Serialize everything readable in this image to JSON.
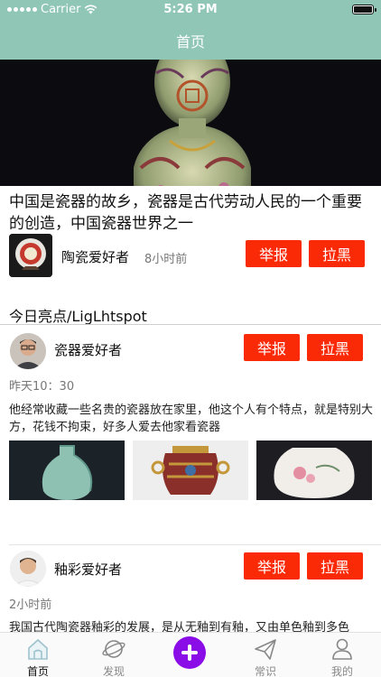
{
  "status_bar": {
    "carrier": "Carrier",
    "time": "5:26 PM"
  },
  "nav": {
    "title": "首页"
  },
  "hero": {
    "caption": "中国是瓷器的故乡，瓷器是古代劳动人民的一个重要的创造，中国瓷器世界之一",
    "author": "陶瓷爱好者",
    "time": "8小时前",
    "report_label": "举报",
    "block_label": "拉黑"
  },
  "section": {
    "title": "今日亮点/LigLhtspot"
  },
  "posts": [
    {
      "author": "瓷器爱好者",
      "time": "昨天10：30",
      "text": "他经常收藏一些名贵的瓷器放在家里，他这个人有个特点，就是特别大方，花钱不拘束，好多人爱去他家看瓷器",
      "report_label": "举报",
      "block_label": "拉黑"
    },
    {
      "author": "釉彩爱好者",
      "time": "2小时前",
      "text": "我国古代陶瓷器釉彩的发展，是从无釉到有釉，又由单色釉到多色",
      "report_label": "举报",
      "block_label": "拉黑"
    }
  ],
  "tabbar": {
    "home": "首页",
    "discover": "发现",
    "knowledge": "常识",
    "mine": "我的"
  },
  "colors": {
    "nav_bg": "#8fc6b6",
    "button": "#fb2a06",
    "plus": "#8a0ce6"
  }
}
